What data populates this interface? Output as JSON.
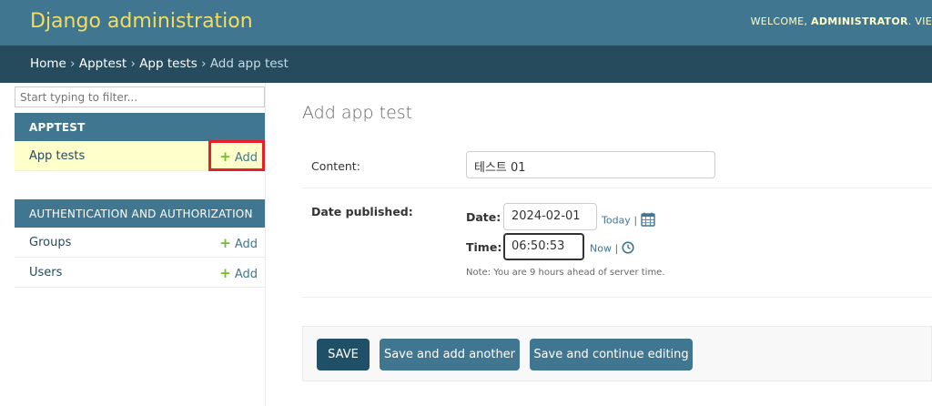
{
  "header": {
    "site_name": "Django administration",
    "welcome": "Welcome,",
    "username": "Administrator",
    "view_site": "Vie"
  },
  "breadcrumbs": {
    "home": "Home",
    "app": "Apptest",
    "model": "App tests",
    "current": "Add app test",
    "separator": "›"
  },
  "sidebar": {
    "filter_placeholder": "Start typing to filter...",
    "modules": [
      {
        "caption": "Apptest",
        "models": [
          {
            "name": "App tests",
            "add_label": "Add",
            "current": true
          }
        ]
      },
      {
        "caption": "Authentication and Authorization",
        "models": [
          {
            "name": "Groups",
            "add_label": "Add"
          },
          {
            "name": "Users",
            "add_label": "Add"
          }
        ]
      }
    ]
  },
  "main": {
    "title": "Add app test",
    "content_field": {
      "label": "Content:",
      "value": "테스트 01"
    },
    "date_published": {
      "label": "Date published:",
      "date_label": "Date:",
      "date_value": "2024-02-01",
      "today_link": "Today",
      "time_label": "Time:",
      "time_value": "06:50:53",
      "now_link": "Now",
      "pipe": "|",
      "help_text": "Note: You are 9 hours ahead of server time."
    }
  },
  "submit_row": {
    "save": "SAVE",
    "save_add_another": "Save and add another",
    "save_continue": "Save and continue editing"
  },
  "colors": {
    "header_bg": "#417690",
    "site_name": "#f5dd5d",
    "breadcrumbs_bg": "#264b5d",
    "highlight": "#e5202a",
    "add_plus": "#70bf2b",
    "current_row": "#ffffcc"
  }
}
